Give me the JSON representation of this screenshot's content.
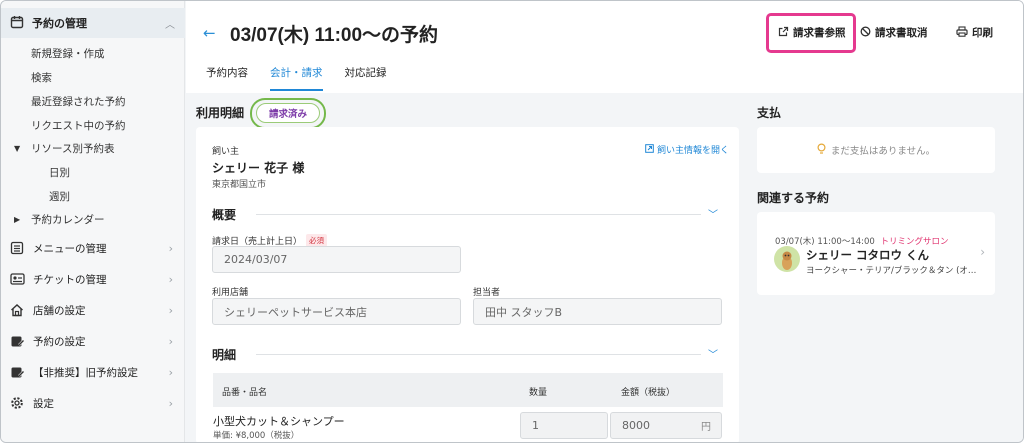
{
  "sidebar": {
    "header": "予約の管理",
    "sub_items": [
      "新規登録・作成",
      "検索",
      "最近登録された予約",
      "リクエスト中の予約"
    ],
    "resource_group": "リソース別予約表",
    "resource_items": [
      "日別",
      "週別"
    ],
    "calendar": "予約カレンダー",
    "sections": [
      "メニューの管理",
      "チケットの管理",
      "店舗の設定",
      "予約の設定",
      "【非推奨】旧予約設定",
      "設定"
    ]
  },
  "header": {
    "back_arrow": "←",
    "title": "03/07(木) 11:00〜の予約",
    "invoice_view": "請求書参照",
    "invoice_cancel": "請求書取消",
    "print": "印刷"
  },
  "tabs": [
    "予約内容",
    "会計・請求",
    "対応記録"
  ],
  "billing": {
    "section_label": "利用明細",
    "status_badge": "請求済み",
    "owner_label": "飼い主",
    "owner_name": "シェリー 花子 様",
    "owner_address": "東京都国立市",
    "owner_link": "飼い主情報を開く",
    "overview_label": "概要",
    "billing_date_label": "請求日（売上計上日）",
    "required": "必須",
    "billing_date_value": "2024/03/07",
    "store_label": "利用店舗",
    "store_value": "シェリーペットサービス本店",
    "staff_label": "担当者",
    "staff_value": "田中 スタッフB",
    "details_label": "明細",
    "table_headers": [
      "品番・品名",
      "数量",
      "金額（税抜）"
    ],
    "item_name": "小型犬カット＆シャンプー",
    "item_unit_price": "単価: ¥8,000（税抜）",
    "item_qty": "1",
    "item_amount": "8000",
    "yen": "円"
  },
  "payment": {
    "label": "支払",
    "empty": "まだ支払はありません。"
  },
  "related": {
    "label": "関連する予約",
    "time": "03/07(木) 11:00〜14:00",
    "category": "トリミングサロン",
    "pet_name": "シェリー コタロウ くん",
    "breed": "ヨークシャー・テリア/ブラック＆タン (オ…"
  },
  "colors": {
    "accent": "#1f87d6",
    "highlight": "#e5398f",
    "badge_ring": "#74b84a",
    "category": "#e0336f"
  }
}
